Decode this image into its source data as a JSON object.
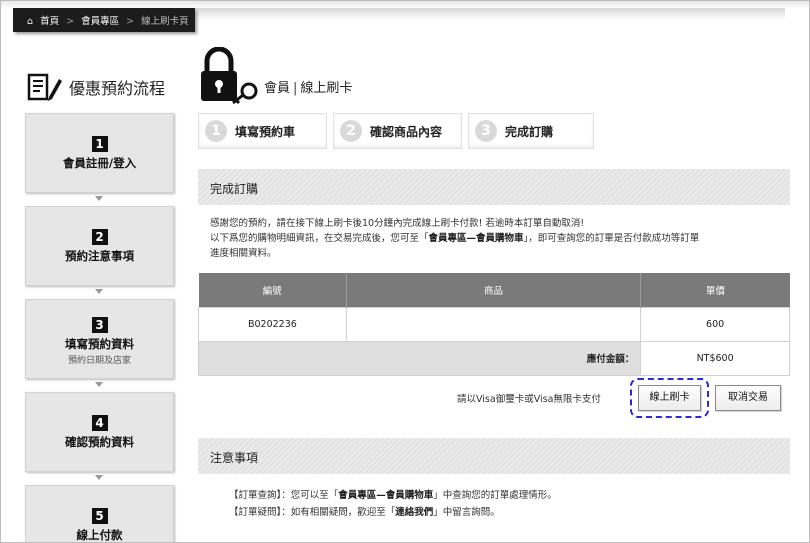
{
  "breadcrumb": {
    "home": "首頁",
    "sep1": ">",
    "member": "會員專區",
    "sep2": ">",
    "current": "線上刷卡頁"
  },
  "sidebar": {
    "title": "優惠預約流程",
    "steps": [
      {
        "num": "1",
        "label": "會員註冊/登入",
        "sub": ""
      },
      {
        "num": "2",
        "label": "預約注意事項",
        "sub": ""
      },
      {
        "num": "3",
        "label": "填寫預約資料",
        "sub": "預約日期及店家"
      },
      {
        "num": "4",
        "label": "確認預約資料",
        "sub": ""
      },
      {
        "num": "5",
        "label": "線上付款",
        "sub": ""
      }
    ]
  },
  "header": {
    "section": "會員",
    "sep": "|",
    "page": "線上刷卡"
  },
  "tabs": [
    {
      "num": "1",
      "label": "填寫預約車"
    },
    {
      "num": "2",
      "label": "確認商品內容"
    },
    {
      "num": "3",
      "label": "完成訂購"
    }
  ],
  "complete": {
    "title": "完成訂購",
    "line1": "感謝您的預約，請在接下線上刷卡後10分鐘內完成線上刷卡付款! 若逾時本訂單自動取消!",
    "line2a": "以下爲您的購物明細資訊，在交易完成後，您可至「",
    "line2b": "會員專區—會員購物車",
    "line2c": "」，即可查詢您的訂單是否付款成功等訂單",
    "line3": "進度相關資料。"
  },
  "table": {
    "headers": [
      "編號",
      "商品",
      "單價"
    ],
    "rows": [
      {
        "id": "B0202236",
        "product": "",
        "price": "600"
      }
    ],
    "total_label": "應付金額：",
    "total_value": "NT$600"
  },
  "payment": {
    "note": "請以Visa御璽卡或Visa無限卡支付",
    "pay_button": "線上刷卡",
    "cancel_button": "取消交易"
  },
  "notice": {
    "title": "注意事項",
    "item1a": "【訂單查詢】：您可以至「",
    "item1b": "會員專區—會員購物車",
    "item1c": "」中查詢您的訂單處理情形。",
    "item2a": "【訂單疑問】：如有相關疑問，歡迎至「",
    "item2b": "連絡我們",
    "item2c": "」中留言詢問。"
  }
}
